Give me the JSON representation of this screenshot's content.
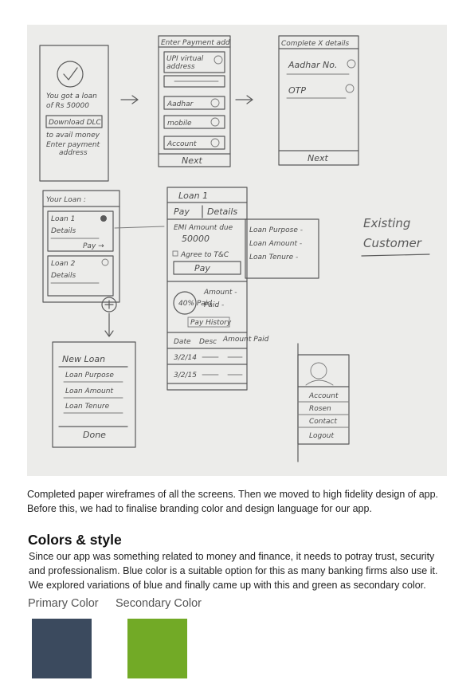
{
  "wireframe": {
    "screen1": {
      "message": [
        "You got a loan",
        "of Rs 50000"
      ],
      "button": "Download DLC",
      "avail": [
        "to avail money",
        "Enter payment",
        "address"
      ]
    },
    "screen2": {
      "title": "Enter Payment add",
      "upi": [
        "UPI virtual",
        "address"
      ],
      "fields": [
        "Aadhar",
        "mobile",
        "Account"
      ],
      "footer": "Next"
    },
    "screen3": {
      "title": "Complete X details",
      "fields": [
        "Aadhar No.",
        "OTP"
      ],
      "footer": "Next"
    },
    "screen4": {
      "title": "Your Loan :",
      "loan1": "Loan 1",
      "details": "Details",
      "pay": "Pay →",
      "loan2": "Loan 2",
      "details2": "Details"
    },
    "screen5": {
      "title": "Loan 1",
      "tabs": [
        "Pay",
        "Details"
      ],
      "emi": "EMI Amount due",
      "amount": "50000",
      "agree": "Agree to T&C",
      "pay": "Pay",
      "progress": "40% Paid",
      "amount_label": "Amount -",
      "paid_label": "Paid -",
      "history": "Pay History",
      "table_headers": [
        "Date",
        "Desc",
        "Amount Paid"
      ],
      "rows": [
        "3/2/14",
        "3/2/15"
      ]
    },
    "details_popout": [
      "Loan Purpose -",
      "Loan Amount -",
      "Loan Tenure -"
    ],
    "existing_customer": [
      "Existing",
      "Customer"
    ],
    "screen6": {
      "title": "New Loan",
      "fields": [
        "Loan Purpose",
        "Loan Amount",
        "Loan Tenure"
      ],
      "footer": "Done"
    },
    "screen7": {
      "menu": [
        "Account",
        "Rosen",
        "Contact",
        "Logout"
      ]
    }
  },
  "caption": "Completed paper wireframes of all the screens. Then we moved to high fidelity design of app. Before this, we had to finalise branding color and design language for our app.",
  "colors_section": {
    "title": "Colors & style",
    "body": "Since our app was something related to money and finance, it needs to potray trust, security and professionalism. Blue color is a suitable option for this as many banking firms also use it. We explored variations of blue and finally came up with this and green as secondary color.",
    "primary_label": "Primary Color",
    "secondary_label": "Secondary Color",
    "primary_color": "#3b4a5e",
    "secondary_color": "#72aa26"
  }
}
